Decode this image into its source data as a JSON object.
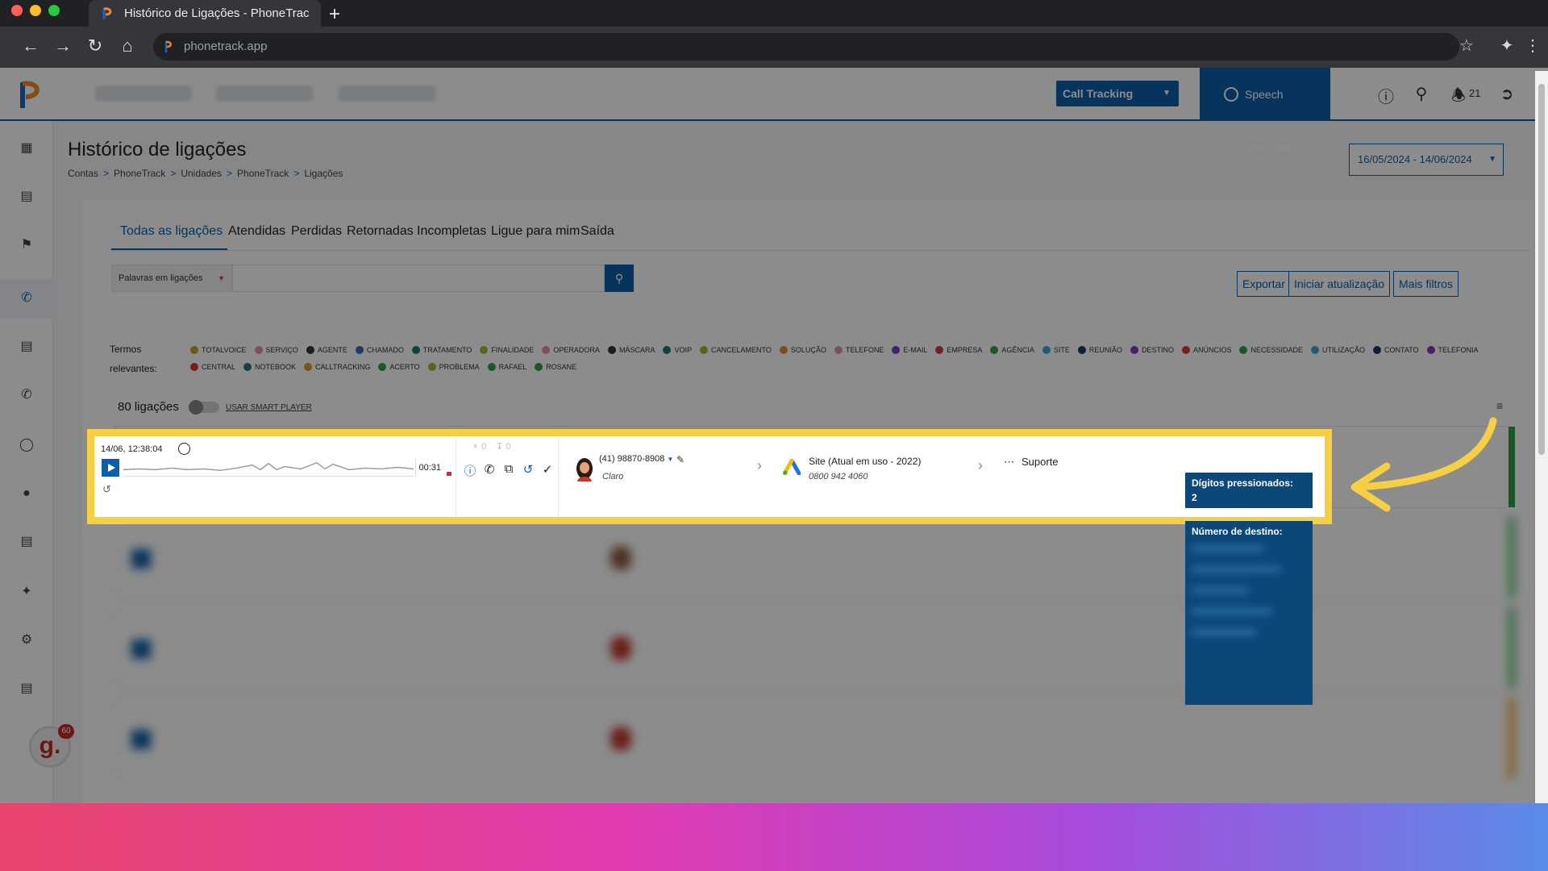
{
  "browser": {
    "tab_title": "Histórico de Ligações - PhoneTrac",
    "new_tab": "+",
    "url": "phonetrack.app"
  },
  "topbar": {
    "call_tracking": "Call Tracking",
    "speech_analytics": "Speech Analytics",
    "notifications": "21"
  },
  "page": {
    "title": "Histórico de ligações",
    "breadcrumb": [
      "Contas",
      "PhoneTrack",
      "Unidades",
      "PhoneTrack",
      "Ligações"
    ],
    "breadcrumb_sep": ">",
    "date_range": "16/05/2024 - 14/06/2024"
  },
  "tabs": [
    "Todas as ligações",
    "Atendidas",
    "Perdidas",
    "Retornadas",
    "Incompletas",
    "Ligue para mim",
    "Saída"
  ],
  "search": {
    "select_label": "Palavras em ligações"
  },
  "actions": {
    "export": "Exportar",
    "start_update": "Iniciar atualização",
    "more_filters": "Mais filtros"
  },
  "terms": {
    "label_line1": "Termos",
    "label_line2": "relevantes:",
    "items": [
      {
        "label": "TOTALVOICE",
        "color": "#c9a227"
      },
      {
        "label": "SERVIÇO",
        "color": "#e58fb0"
      },
      {
        "label": "AGENTE",
        "color": "#333333"
      },
      {
        "label": "CHAMADO",
        "color": "#2f6bc4"
      },
      {
        "label": "TRATAMENTO",
        "color": "#1d7a6c"
      },
      {
        "label": "FINALIDADE",
        "color": "#a6b82d"
      },
      {
        "label": "OPERADORA",
        "color": "#e58fb0"
      },
      {
        "label": "MÁSCARA",
        "color": "#333333"
      },
      {
        "label": "VOIP",
        "color": "#1d7a6c"
      },
      {
        "label": "CANCELAMENTO",
        "color": "#a6b82d"
      },
      {
        "label": "SOLUÇÃO",
        "color": "#e0892b"
      },
      {
        "label": "TELEFONE",
        "color": "#e58fb0"
      },
      {
        "label": "E-MAIL",
        "color": "#7b3fc4"
      },
      {
        "label": "EMPRESA",
        "color": "#d93a3a"
      },
      {
        "label": "AGÊNCIA",
        "color": "#2e9e4a"
      },
      {
        "label": "SITE",
        "color": "#3fa6d9"
      },
      {
        "label": "REUNIÃO",
        "color": "#1b3a6b"
      },
      {
        "label": "DESTINO",
        "color": "#7b3fc4"
      },
      {
        "label": "ANÚNCIOS",
        "color": "#d93a3a"
      },
      {
        "label": "NECESSIDADE",
        "color": "#2e9e4a"
      },
      {
        "label": "UTILIZAÇÃO",
        "color": "#3fa6d9"
      },
      {
        "label": "CONTATO",
        "color": "#1b3a6b"
      },
      {
        "label": "TELEFONIA",
        "color": "#7b3fc4"
      },
      {
        "label": "CENTRAL",
        "color": "#d93a3a"
      },
      {
        "label": "NOTEBOOK",
        "color": "#1d7a6c"
      },
      {
        "label": "CALLTRACKING",
        "color": "#c9a227"
      },
      {
        "label": "ACERTO",
        "color": "#2e9e4a"
      },
      {
        "label": "PROBLEMA",
        "color": "#a6b82d"
      },
      {
        "label": "RAFAEL",
        "color": "#2e9e4a"
      },
      {
        "label": "ROSANE",
        "color": "#2e9e4a"
      }
    ]
  },
  "list": {
    "count": "80 ligações",
    "smart_player": "USAR SMART PLAYER"
  },
  "call": {
    "datetime": "14/06, 12:38:04",
    "listens": "0",
    "downloads": "0",
    "duration": "00:31",
    "phone": "(41) 98870-8908",
    "carrier": "Claro",
    "source": "Site (Atual em uso - 2022)",
    "tracking_number": "0800 942 4060",
    "destination": "Suporte"
  },
  "tooltip": {
    "digits_label": "Dígitos pressionados:",
    "digits_value": "2",
    "dest_label": "Número de destino:"
  },
  "chat_badge": "60"
}
